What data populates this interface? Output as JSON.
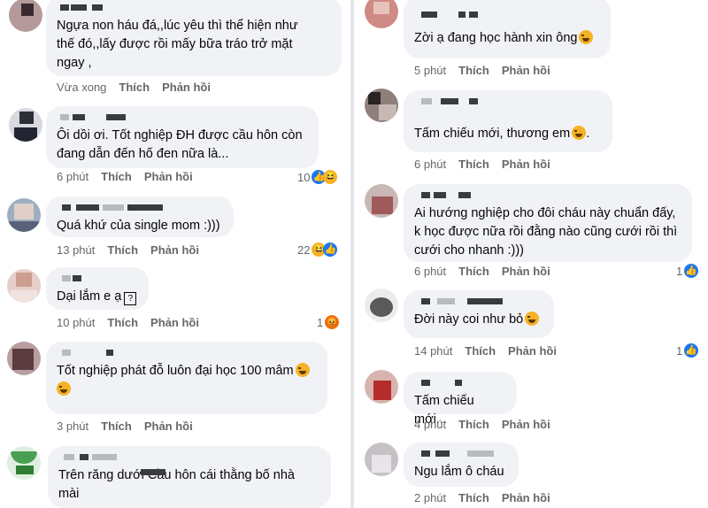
{
  "actions": {
    "like": "Thích",
    "reply": "Phản hồi"
  },
  "left": [
    {
      "lines": [
        "Ngựa non háu đá,,lúc yêu thì thể hiện như",
        "thế đó,,lấy được rồi mấy bữa tráo trở mặt",
        "ngay ,"
      ],
      "time": "Vừa xong",
      "reaction_count": "",
      "reaction": ""
    },
    {
      "lines": [
        "Ôi dồi ơi. Tốt nghiệp  ĐH được cầu hôn còn",
        "đang  dẫn đến hố đen nữa là..."
      ],
      "time": "6 phút",
      "reaction_count": "10",
      "reaction": "like-haha"
    },
    {
      "lines": [
        "Quá khứ của single mom :)))"
      ],
      "time": "13 phút",
      "reaction_count": "22",
      "reaction": "haha-like"
    },
    {
      "lines": [
        "Dại lắm e ạ"
      ],
      "time": "10 phút",
      "reaction_count": "1",
      "reaction": "angry"
    },
    {
      "lines": [
        "Tốt nghiệp phát đỗ luôn đại học 100 mâm"
      ],
      "time": "3 phút",
      "reaction_count": "",
      "reaction": ""
    },
    {
      "lines": [
        "Trên răng dưới       Cầu hôn cái thằng bố nhà",
        "mài"
      ],
      "time": "",
      "reaction_count": "",
      "reaction": ""
    }
  ],
  "right": [
    {
      "lines": [
        "Zời ạ đang học hành xin ông"
      ],
      "time": "5 phút",
      "reaction_count": "",
      "reaction": ""
    },
    {
      "lines": [
        "Tấm chiếu mới, thương em"
      ],
      "time": "6 phút",
      "reaction_count": "",
      "reaction": ""
    },
    {
      "lines": [
        "Ai hướng nghiệp cho đôi cháu này chuẩn đấy,",
        "k học được nữa rồi đằng nào cũng cưới rồi thì",
        "cưới cho nhanh :)))"
      ],
      "time": "6 phút",
      "reaction_count": "1",
      "reaction": "like"
    },
    {
      "lines": [
        "Đời này coi như bỏ"
      ],
      "time": "14 phút",
      "reaction_count": "1",
      "reaction": "like"
    },
    {
      "lines": [
        "Tấm chiếu mới..."
      ],
      "time": "4 phút",
      "reaction_count": "",
      "reaction": ""
    },
    {
      "lines": [
        "Ngu lắm ô cháu"
      ],
      "time": "2 phút",
      "reaction_count": "",
      "reaction": ""
    }
  ]
}
